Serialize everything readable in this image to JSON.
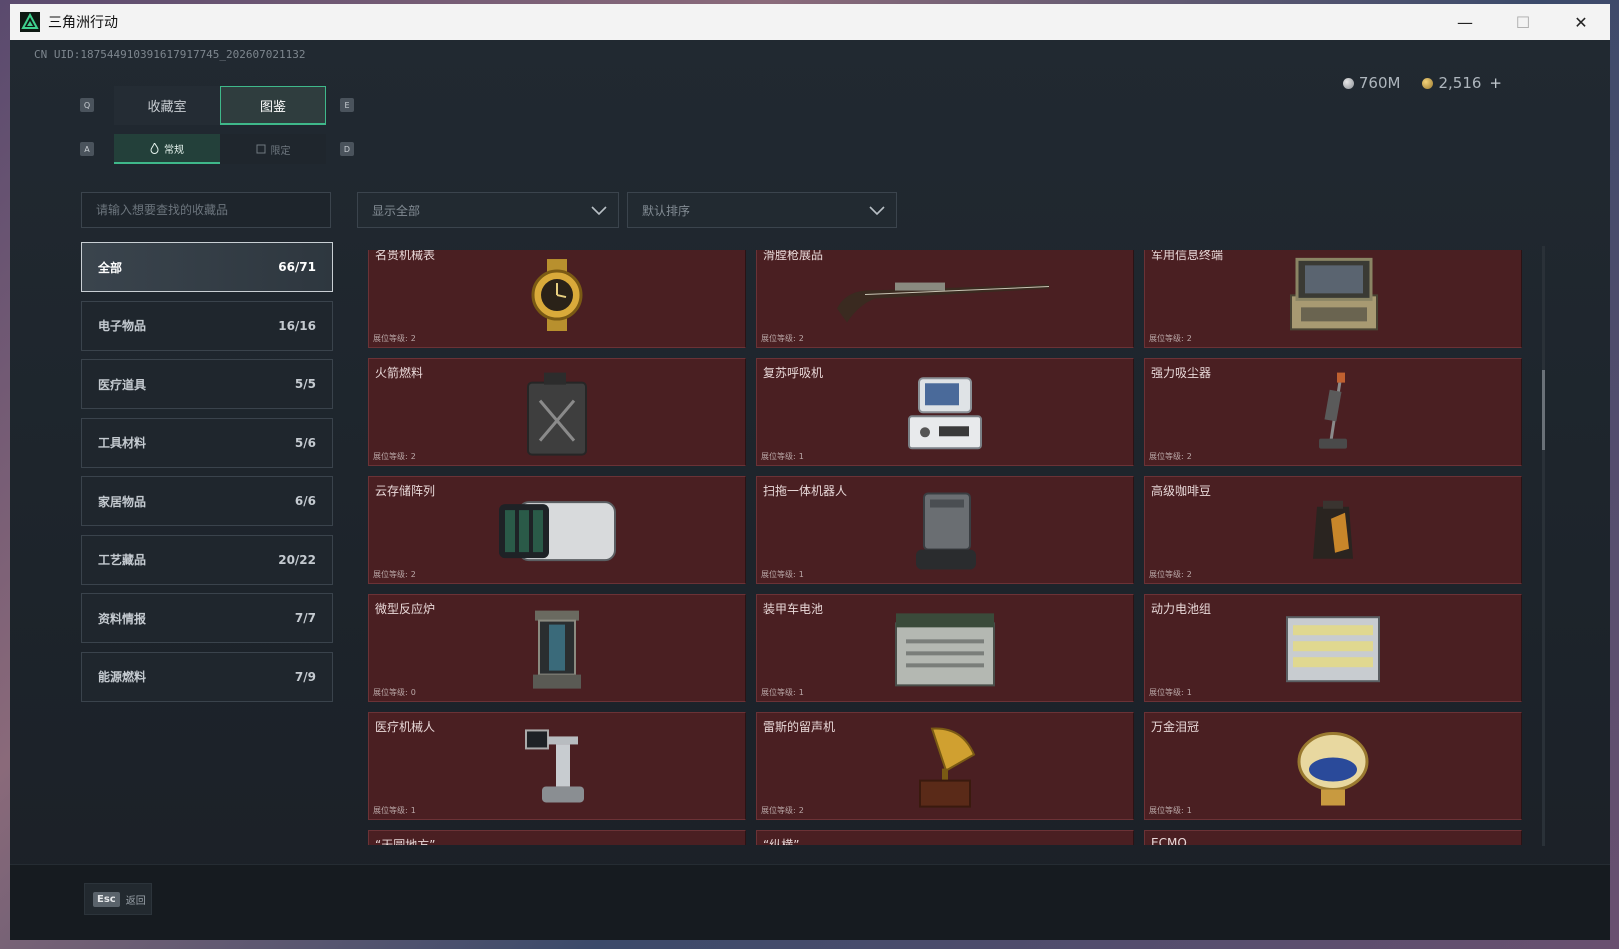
{
  "window": {
    "title": "三角洲行动",
    "min_icon": "minimize-icon",
    "max_icon": "maximize-icon",
    "close_icon": "close-icon"
  },
  "uid": "CN UID:187544910391617917745_202607021132",
  "currency": {
    "silver": "760M",
    "gold": "2,516",
    "plus": "+"
  },
  "tabs": [
    {
      "label": "收藏室",
      "active": false
    },
    {
      "label": "图鉴",
      "active": true
    }
  ],
  "tab_keys": {
    "left": "Q",
    "right": "E"
  },
  "subtabs": [
    {
      "label": "常规",
      "icon": "flame-icon",
      "active": true
    },
    {
      "label": "限定",
      "icon": "badge-icon",
      "active": false
    }
  ],
  "subtab_keys": {
    "left": "A",
    "right": "D"
  },
  "search": {
    "placeholder": "请输入想要查找的收藏品"
  },
  "filter": {
    "value": "显示全部"
  },
  "sort": {
    "value": "默认排序"
  },
  "categories": [
    {
      "label": "全部",
      "count": "66/71",
      "active": true
    },
    {
      "label": "电子物品",
      "count": "16/16"
    },
    {
      "label": "医疗道具",
      "count": "5/5"
    },
    {
      "label": "工具材料",
      "count": "5/6"
    },
    {
      "label": "家居物品",
      "count": "6/6"
    },
    {
      "label": "工艺藏品",
      "count": "20/22"
    },
    {
      "label": "资料情报",
      "count": "7/7"
    },
    {
      "label": "能源燃料",
      "count": "7/9"
    }
  ],
  "level_label": "展位等级:",
  "items": [
    {
      "name": "名贵机械表",
      "level": "2",
      "icon": "watch-icon"
    },
    {
      "name": "滑膛枪展品",
      "level": "2",
      "icon": "musket-icon"
    },
    {
      "name": "军用信息终端",
      "level": "2",
      "icon": "terminal-icon"
    },
    {
      "name": "火箭燃料",
      "level": "2",
      "icon": "fuel-can-icon"
    },
    {
      "name": "复苏呼吸机",
      "level": "1",
      "icon": "ventilator-icon"
    },
    {
      "name": "强力吸尘器",
      "level": "2",
      "icon": "vacuum-icon"
    },
    {
      "name": "云存储阵列",
      "level": "2",
      "icon": "storage-array-icon"
    },
    {
      "name": "扫拖一体机器人",
      "level": "1",
      "icon": "robot-mop-icon"
    },
    {
      "name": "高级咖啡豆",
      "level": "2",
      "icon": "coffee-bag-icon"
    },
    {
      "name": "微型反应炉",
      "level": "0",
      "icon": "reactor-icon"
    },
    {
      "name": "装甲车电池",
      "level": "1",
      "icon": "battery-icon"
    },
    {
      "name": "动力电池组",
      "level": "1",
      "icon": "battery-pack-icon"
    },
    {
      "name": "医疗机械人",
      "level": "1",
      "icon": "medical-robot-icon"
    },
    {
      "name": "雷斯的留声机",
      "level": "2",
      "icon": "gramophone-icon"
    },
    {
      "name": "万金泪冠",
      "level": "1",
      "icon": "jeweled-egg-icon"
    },
    {
      "name": "“天圆地方”",
      "level": "",
      "icon": "coin-icon"
    },
    {
      "name": "“纵横”",
      "level": "",
      "icon": "ornament-icon"
    },
    {
      "name": "ECMO",
      "level": "",
      "icon": "ecmo-icon"
    }
  ],
  "footer": {
    "key": "Esc",
    "label": "返回"
  }
}
